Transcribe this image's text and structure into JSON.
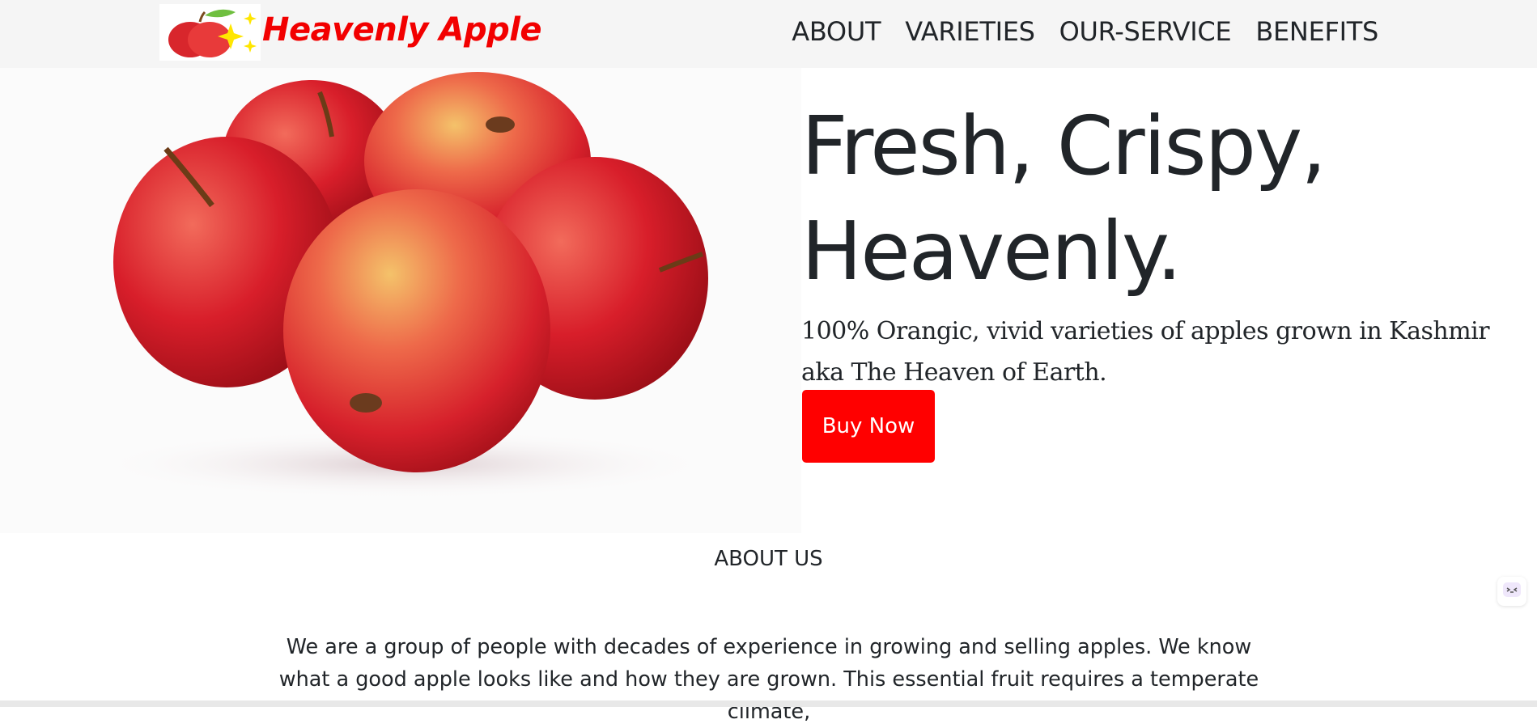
{
  "brand": {
    "name": "Heavenly Apple",
    "logo_icon": "apple-sparkle-logo"
  },
  "nav": {
    "items": [
      {
        "label": "ABOUT"
      },
      {
        "label": "VARIETIES"
      },
      {
        "label": "OUR-SERVICE"
      },
      {
        "label": "BENEFITS"
      }
    ]
  },
  "hero": {
    "image_icon": "red-apples-image",
    "title_line1": "Fresh, Crispy,",
    "title_line2": "Heavenly.",
    "subtitle": "100% Orangic, vivid varieties of apples grown in Kashmir aka The Heaven of Earth.",
    "cta_label": "Buy Now"
  },
  "about": {
    "heading": "ABOUT US",
    "text": "We are a group of people with decades of experience in growing and selling apples. We know what a good apple looks like and how they are grown. This essential fruit requires a temperate climate,"
  },
  "widget": {
    "icon": "assistant-widget-icon"
  },
  "colors": {
    "accent": "#ff0000",
    "brand_text": "#f20000",
    "navbar_bg": "#f5f5f5",
    "text": "#212529"
  }
}
